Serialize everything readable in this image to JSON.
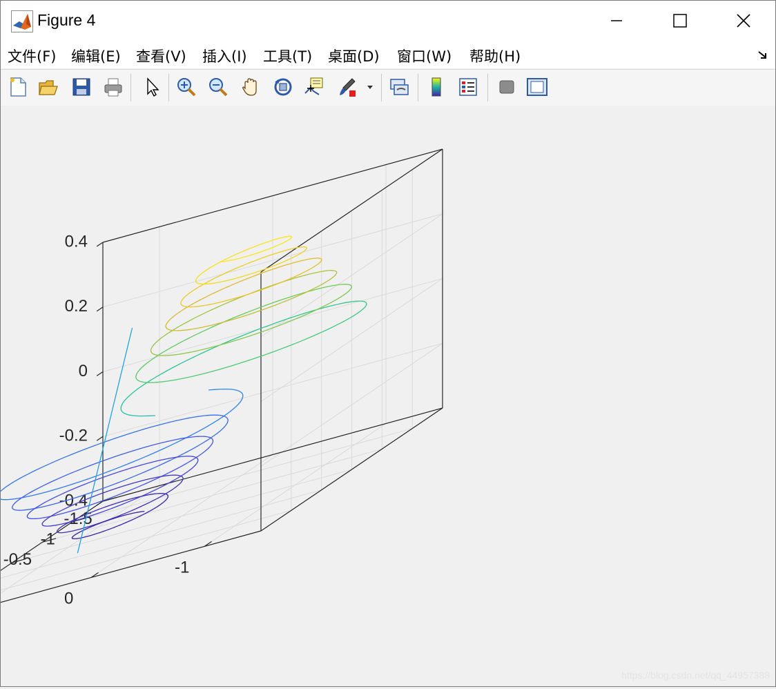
{
  "window": {
    "title": "Figure 4"
  },
  "menubar": {
    "items": [
      "文件(F)",
      "编辑(E)",
      "查看(V)",
      "插入(I)",
      "工具(T)",
      "桌面(D)",
      "窗口(W)",
      "帮助(H)"
    ]
  },
  "toolbar": {
    "buttons": [
      "new-figure-icon",
      "open-file-icon",
      "save-icon",
      "print-icon",
      "pointer-icon",
      "zoom-in-icon",
      "zoom-out-icon",
      "pan-hand-icon",
      "rotate-3d-icon",
      "data-cursor-icon",
      "brush-icon",
      "link-plot-icon",
      "colorbar-icon",
      "legend-icon",
      "hide-plot-tools-icon",
      "show-plot-tools-icon"
    ]
  },
  "watermark": "https://blog.csdn.net/qq_44957388",
  "chart_data": {
    "type": "line",
    "plot": "3-D line (plot3)",
    "title": "",
    "xlabel": "",
    "ylabel": "",
    "zlabel": "",
    "xlim": [
      -1.5,
      1.5
    ],
    "ylim": [
      -1.5,
      1.5
    ],
    "zlim": [
      -0.4,
      0.4
    ],
    "xticks": [
      "-1.5",
      "-1",
      "-0.5",
      "0",
      "0.5",
      "1",
      "1.5"
    ],
    "yticks": [
      "-1",
      "0",
      "1"
    ],
    "zticks": [
      "-0.4",
      "-0.2",
      "0",
      "0.2",
      "0.4"
    ],
    "grid": true,
    "box": true,
    "colormap": "parula",
    "series": [
      {
        "description": "lower spiral, centred near x=-0.6, y=0.9, descending from z≈-0.15 (radius≈1.0) to z≈-0.42 (radius≈0.3)",
        "center": [
          -0.6,
          0.9
        ],
        "z_start": -0.15,
        "z_end": -0.42,
        "radius_start": 1.0,
        "radius_end": 0.3,
        "turns": 6
      },
      {
        "description": "connecting segment from lower spiral to upper spiral",
        "from": [
          0.6,
          0.6,
          -0.38
        ],
        "to": [
          -0.3,
          0.6,
          0.2
        ]
      },
      {
        "description": "upper spiral, centred near x=0.6, y=-0.9, ascending from z≈0.05 (radius≈1.0) to z≈0.42 (radius≈0.3)",
        "center": [
          0.6,
          -0.9
        ],
        "z_start": 0.05,
        "z_end": 0.42,
        "radius_start": 1.0,
        "radius_end": 0.3,
        "turns": 6
      }
    ]
  }
}
